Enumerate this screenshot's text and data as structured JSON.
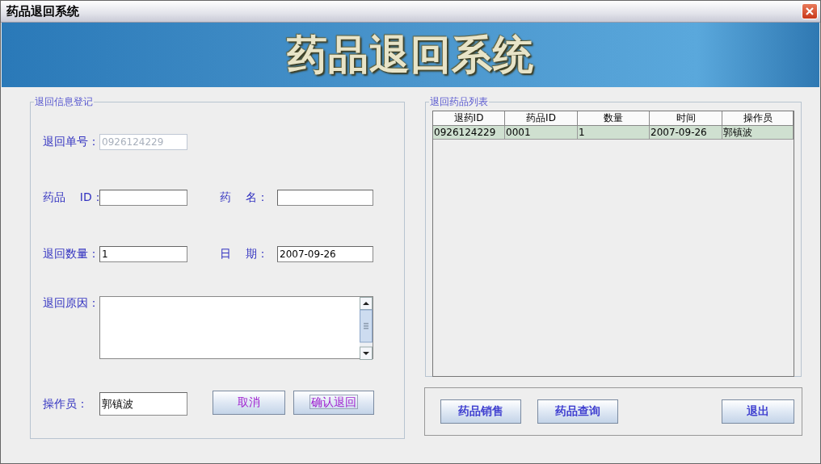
{
  "window": {
    "title": "药品退回系统"
  },
  "banner": {
    "title": "药品退回系统"
  },
  "form": {
    "legend": "退回信息登记",
    "return_no": {
      "label": "退回单号：",
      "value": "0926124229",
      "disabled": true
    },
    "drug_id": {
      "label": "药品    ID："
    },
    "drug_name": {
      "label": "药    名："
    },
    "quantity": {
      "label": "退回数量：",
      "value": "1"
    },
    "date": {
      "label": "日    期：",
      "value": "2007-09-26"
    },
    "reason": {
      "label": "退回原因："
    },
    "operator": {
      "label": "操作员：",
      "value": "郭镇波"
    },
    "buttons": [
      {
        "label": "取消",
        "focused": false
      },
      {
        "label": "确认退回",
        "focused": true
      }
    ]
  },
  "list": {
    "legend": "退回药品列表",
    "columns": [
      "退药ID",
      "药品ID",
      "数量",
      "时间",
      "操作员"
    ],
    "rows": [
      {
        "cells": [
          "0926124229",
          "0001",
          "1",
          "2007-09-26",
          "郭镇波"
        ],
        "selected": true
      }
    ]
  },
  "nav_buttons": [
    "药品销售",
    "药品查询",
    "退出"
  ]
}
